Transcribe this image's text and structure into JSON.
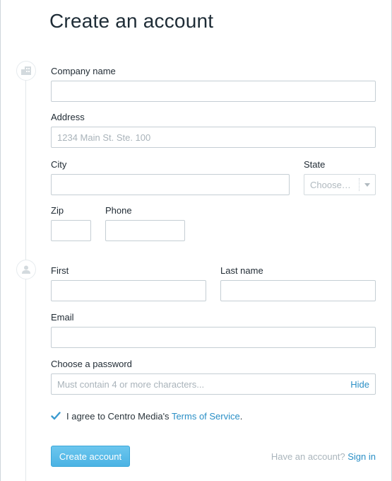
{
  "title": "Create an account",
  "company": {
    "company_label": "Company name",
    "company_value": "",
    "company_placeholder": "",
    "address_label": "Address",
    "address_placeholder": "1234 Main St. Ste. 100",
    "city_label": "City",
    "state_label": "State",
    "state_value": "Choose…",
    "zip_label": "Zip",
    "phone_label": "Phone"
  },
  "person": {
    "first_label": "First",
    "last_label": "Last name",
    "email_label": "Email",
    "password_label": "Choose a password",
    "password_placeholder": "Must contain 4 or more characters...",
    "hide_label": "Hide"
  },
  "terms": {
    "checked": true,
    "prefix": "I agree to Centro Media's ",
    "link": "Terms of Service",
    "suffix": "."
  },
  "actions": {
    "create_label": "Create account",
    "have_account": "Have an account? ",
    "signin_label": "Sign in"
  },
  "icons": {
    "company_step": "building-icon",
    "person_step": "user-icon"
  },
  "colors": {
    "accent": "#2a8fc6",
    "button": "#4bb3e4"
  }
}
